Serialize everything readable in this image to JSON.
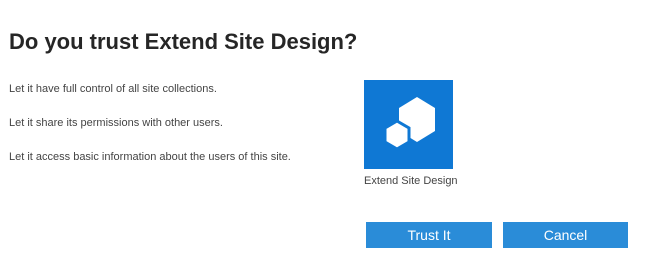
{
  "dialog": {
    "title": "Do you trust Extend Site Design?",
    "permissions": [
      "Let it have full control of all site collections.",
      "Let it share its permissions with other users.",
      "Let it access basic information about the users of this site."
    ]
  },
  "app": {
    "name": "Extend Site Design",
    "icon": "app-hexagon-icon",
    "tile_color": "#0f78d4"
  },
  "buttons": {
    "trust_label": "Trust It",
    "cancel_label": "Cancel",
    "color": "#2a8cd8"
  }
}
